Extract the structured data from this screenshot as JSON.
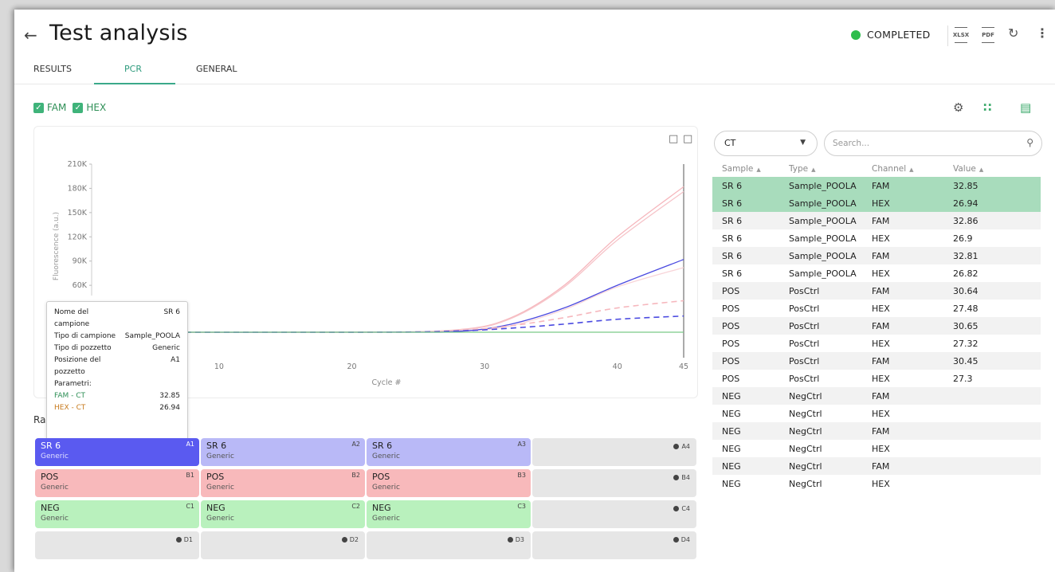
{
  "header": {
    "back_icon": "arrow-left",
    "title": "Test analysis",
    "status_label": "COMPLETED",
    "status_color": "#2ebd4c",
    "xlsx_label": "XLSX",
    "pdf_label": "PDF"
  },
  "tabs": [
    {
      "label": "RESULTS",
      "active": false
    },
    {
      "label": "PCR",
      "active": true
    },
    {
      "label": "GENERAL",
      "active": false
    }
  ],
  "channels": [
    {
      "label": "FAM",
      "checked": true
    },
    {
      "label": "HEX",
      "checked": true
    }
  ],
  "chart_data": {
    "type": "line",
    "xlabel": "Cycle #",
    "ylabel": "Fluorescence (a.u.)",
    "x_ticks": [
      10,
      20,
      30,
      40,
      45
    ],
    "y_ticks": [
      "210K",
      "180K",
      "150K",
      "120K",
      "90K",
      "60K"
    ],
    "xlim": [
      1,
      45
    ],
    "ylim": [
      0,
      210000
    ],
    "series": [
      {
        "values": [
          [
            1,
            2000
          ],
          [
            20,
            2000
          ],
          [
            28,
            5000
          ],
          [
            32,
            20000
          ],
          [
            36,
            60000
          ],
          [
            40,
            120000
          ],
          [
            45,
            182000
          ]
        ],
        "color": "#f6b7bd",
        "dash": false
      },
      {
        "values": [
          [
            1,
            2000
          ],
          [
            20,
            2000
          ],
          [
            28,
            4500
          ],
          [
            32,
            19000
          ],
          [
            36,
            58000
          ],
          [
            40,
            116000
          ],
          [
            45,
            176000
          ]
        ],
        "color": "#f6c4c9",
        "dash": false
      },
      {
        "values": [
          [
            1,
            2000
          ],
          [
            20,
            2000
          ],
          [
            28,
            3000
          ],
          [
            32,
            10000
          ],
          [
            36,
            30000
          ],
          [
            40,
            58000
          ],
          [
            45,
            82000
          ]
        ],
        "color": "#f8d4d8",
        "dash": false
      },
      {
        "values": [
          [
            1,
            2000
          ],
          [
            22,
            2000
          ],
          [
            28,
            3000
          ],
          [
            32,
            12000
          ],
          [
            36,
            32000
          ],
          [
            40,
            60000
          ],
          [
            45,
            92000
          ]
        ],
        "color": "#4a4ae0",
        "dash": false
      },
      {
        "values": [
          [
            1,
            2000
          ],
          [
            22,
            2000
          ],
          [
            28,
            4000
          ],
          [
            32,
            10000
          ],
          [
            36,
            20000
          ],
          [
            40,
            32000
          ],
          [
            45,
            41000
          ]
        ],
        "color": "#f6b7bd",
        "dash": true
      },
      {
        "values": [
          [
            1,
            2000
          ],
          [
            22,
            2000
          ],
          [
            28,
            3500
          ],
          [
            32,
            7000
          ],
          [
            36,
            12000
          ],
          [
            40,
            18000
          ],
          [
            45,
            22000
          ]
        ],
        "color": "#4a4ae0",
        "dash": true
      },
      {
        "values": [
          [
            1,
            2000
          ],
          [
            45,
            2000
          ]
        ],
        "color": "#7acb86",
        "dash": false
      }
    ]
  },
  "tooltip": [
    {
      "k": "Nome del campione",
      "v": "SR 6"
    },
    {
      "k": "Tipo di campione",
      "v": "Sample_POOLA"
    },
    {
      "k": "Tipo di pozzetto",
      "v": "Generic"
    },
    {
      "k": "Posizione del pozzetto",
      "v": "A1"
    },
    {
      "k": "Parametri:",
      "v": ""
    },
    {
      "k": "FAM - CT",
      "v": "32.85",
      "color": "#2e8f56"
    },
    {
      "k": "HEX - CT",
      "v": "26.94",
      "color": "#c77a1c"
    }
  ],
  "raw_label": "Ra",
  "plate": [
    [
      {
        "name": "SR 6",
        "type": "Generic",
        "pos": "A1",
        "bg": "#5a5af0",
        "empty": false
      },
      {
        "name": "SR 6",
        "type": "Generic",
        "pos": "A2",
        "bg": "#b9b9f7",
        "empty": false
      },
      {
        "name": "SR 6",
        "type": "Generic",
        "pos": "A3",
        "bg": "#b9b9f7",
        "empty": false
      },
      {
        "name": "",
        "type": "",
        "pos": "A4",
        "bg": "#e6e6e6",
        "empty": true
      }
    ],
    [
      {
        "name": "POS",
        "type": "Generic",
        "pos": "B1",
        "bg": "#f8b9bb",
        "empty": false
      },
      {
        "name": "POS",
        "type": "Generic",
        "pos": "B2",
        "bg": "#f8b9bb",
        "empty": false
      },
      {
        "name": "POS",
        "type": "Generic",
        "pos": "B3",
        "bg": "#f8b9bb",
        "empty": false
      },
      {
        "name": "",
        "type": "",
        "pos": "B4",
        "bg": "#e6e6e6",
        "empty": true
      }
    ],
    [
      {
        "name": "NEG",
        "type": "Generic",
        "pos": "C1",
        "bg": "#b9f1bd",
        "empty": false
      },
      {
        "name": "NEG",
        "type": "Generic",
        "pos": "C2",
        "bg": "#b9f1bd",
        "empty": false
      },
      {
        "name": "NEG",
        "type": "Generic",
        "pos": "C3",
        "bg": "#b9f1bd",
        "empty": false
      },
      {
        "name": "",
        "type": "",
        "pos": "C4",
        "bg": "#e6e6e6",
        "empty": true
      }
    ],
    [
      {
        "name": "",
        "type": "",
        "pos": "D1",
        "bg": "#e6e6e6",
        "empty": true
      },
      {
        "name": "",
        "type": "",
        "pos": "D2",
        "bg": "#e6e6e6",
        "empty": true
      },
      {
        "name": "",
        "type": "",
        "pos": "D3",
        "bg": "#e6e6e6",
        "empty": true
      },
      {
        "name": "",
        "type": "",
        "pos": "D4",
        "bg": "#e6e6e6",
        "empty": true
      }
    ]
  ],
  "filter": {
    "ct_value": "CT",
    "search_placeholder": "Search..."
  },
  "table": {
    "columns": [
      "Sample",
      "Type",
      "Channel",
      "Value"
    ],
    "rows": [
      {
        "sample": "SR 6",
        "type": "Sample_POOLA",
        "channel": "FAM",
        "value": "32.85",
        "selected": true
      },
      {
        "sample": "SR 6",
        "type": "Sample_POOLA",
        "channel": "HEX",
        "value": "26.94",
        "selected": true
      },
      {
        "sample": "SR 6",
        "type": "Sample_POOLA",
        "channel": "FAM",
        "value": "32.86",
        "selected": false
      },
      {
        "sample": "SR 6",
        "type": "Sample_POOLA",
        "channel": "HEX",
        "value": "26.9",
        "selected": false
      },
      {
        "sample": "SR 6",
        "type": "Sample_POOLA",
        "channel": "FAM",
        "value": "32.81",
        "selected": false
      },
      {
        "sample": "SR 6",
        "type": "Sample_POOLA",
        "channel": "HEX",
        "value": "26.82",
        "selected": false
      },
      {
        "sample": "POS",
        "type": "PosCtrl",
        "channel": "FAM",
        "value": "30.64",
        "selected": false
      },
      {
        "sample": "POS",
        "type": "PosCtrl",
        "channel": "HEX",
        "value": "27.48",
        "selected": false
      },
      {
        "sample": "POS",
        "type": "PosCtrl",
        "channel": "FAM",
        "value": "30.65",
        "selected": false
      },
      {
        "sample": "POS",
        "type": "PosCtrl",
        "channel": "HEX",
        "value": "27.32",
        "selected": false
      },
      {
        "sample": "POS",
        "type": "PosCtrl",
        "channel": "FAM",
        "value": "30.45",
        "selected": false
      },
      {
        "sample": "POS",
        "type": "PosCtrl",
        "channel": "HEX",
        "value": "27.3",
        "selected": false
      },
      {
        "sample": "NEG",
        "type": "NegCtrl",
        "channel": "FAM",
        "value": "",
        "selected": false
      },
      {
        "sample": "NEG",
        "type": "NegCtrl",
        "channel": "HEX",
        "value": "",
        "selected": false
      },
      {
        "sample": "NEG",
        "type": "NegCtrl",
        "channel": "FAM",
        "value": "",
        "selected": false
      },
      {
        "sample": "NEG",
        "type": "NegCtrl",
        "channel": "HEX",
        "value": "",
        "selected": false
      },
      {
        "sample": "NEG",
        "type": "NegCtrl",
        "channel": "FAM",
        "value": "",
        "selected": false
      },
      {
        "sample": "NEG",
        "type": "NegCtrl",
        "channel": "HEX",
        "value": "",
        "selected": false
      }
    ]
  }
}
